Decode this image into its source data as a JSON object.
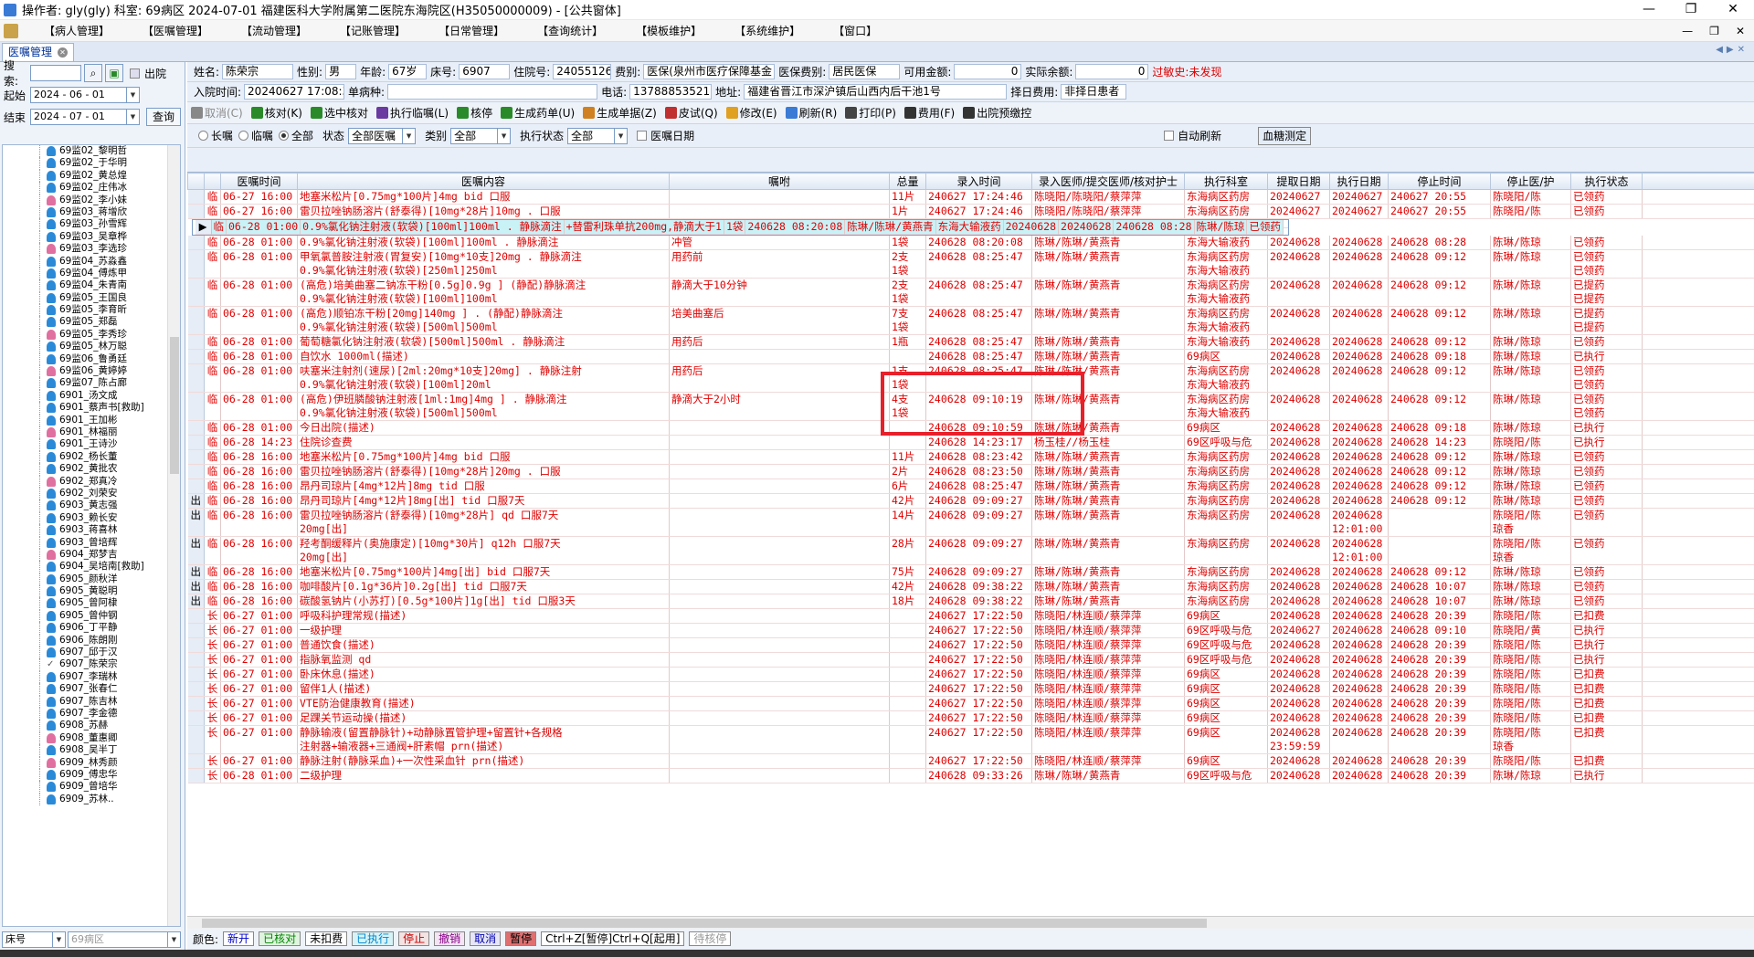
{
  "window": {
    "title": "操作者: gly(gly)  科室: 69病区  2024-07-01  福建医科大学附属第二医院东海院区(H35050000009) - [公共窗体]",
    "controls": [
      "—",
      "❐",
      "✕"
    ]
  },
  "menu": {
    "items": [
      "【病人管理】",
      "【医嘱管理】",
      "【流动管理】",
      "【记账管理】",
      "【日常管理】",
      "【查询统计】",
      "【模板维护】",
      "【系统维护】",
      "【窗口】"
    ],
    "right_controls": [
      "—",
      "❐",
      "✕"
    ]
  },
  "tab": {
    "label": "医嘱管理"
  },
  "left": {
    "search_label": "搜索:",
    "out_label": "出院",
    "start_label": "起始",
    "start_date": "2024 - 06 - 01",
    "end_label": "结束",
    "end_date": "2024 - 07 - 01",
    "query_btn": "查询",
    "bottom_field": "床号",
    "bottom_value": "69病区",
    "patients": [
      {
        "t": "69监02_黎明哲",
        "c": "b"
      },
      {
        "t": "69监02_于华明",
        "c": "b"
      },
      {
        "t": "69监02_黄总煌",
        "c": "b"
      },
      {
        "t": "69监02_庄伟冰",
        "c": "b"
      },
      {
        "t": "69监02_李小妹",
        "c": "p"
      },
      {
        "t": "69监03_蒋增欣",
        "c": "b"
      },
      {
        "t": "69监03_孙雪辉",
        "c": "b"
      },
      {
        "t": "69监03_吴章桦",
        "c": "b"
      },
      {
        "t": "69监03_李选珍",
        "c": "p"
      },
      {
        "t": "69监04_苏淼鑫",
        "c": "b"
      },
      {
        "t": "69监04_傅炼甲",
        "c": "b"
      },
      {
        "t": "69监04_朱青南",
        "c": "b"
      },
      {
        "t": "69监05_王国良",
        "c": "b"
      },
      {
        "t": "69监05_李育昕",
        "c": "b"
      },
      {
        "t": "69监05_郑磊",
        "c": "b"
      },
      {
        "t": "69监05_李秀珍",
        "c": "p"
      },
      {
        "t": "69监05_林万聪",
        "c": "b"
      },
      {
        "t": "69监06_鲁勇廷",
        "c": "b"
      },
      {
        "t": "69监06_黄婷婷",
        "c": "p"
      },
      {
        "t": "69监07_陈占廊",
        "c": "b"
      },
      {
        "t": "6901_汤文成",
        "c": "b"
      },
      {
        "t": "6901_蔡声书[救助]",
        "c": "b"
      },
      {
        "t": "6901_王加彬",
        "c": "b"
      },
      {
        "t": "6901_林福丽",
        "c": "p"
      },
      {
        "t": "6901_王诗沙",
        "c": "b"
      },
      {
        "t": "6902_杨长董",
        "c": "b"
      },
      {
        "t": "6902_黄批农",
        "c": "b"
      },
      {
        "t": "6902_郑真冷",
        "c": "p"
      },
      {
        "t": "6902_刘荣安",
        "c": "b"
      },
      {
        "t": "6903_黄志强",
        "c": "b"
      },
      {
        "t": "6903_赖长安",
        "c": "b"
      },
      {
        "t": "6903_蒋喜林",
        "c": "b"
      },
      {
        "t": "6903_曾培辉",
        "c": "b"
      },
      {
        "t": "6904_郑梦吉",
        "c": "p"
      },
      {
        "t": "6904_吴培南[救助]",
        "c": "b"
      },
      {
        "t": "6905_颜秋洋",
        "c": "b"
      },
      {
        "t": "6905_黄聪明",
        "c": "b"
      },
      {
        "t": "6905_曾阿棣",
        "c": "b"
      },
      {
        "t": "6905_曾仲钢",
        "c": "b"
      },
      {
        "t": "6906_丁平静",
        "c": "b"
      },
      {
        "t": "6906_陈朗刚",
        "c": "b"
      },
      {
        "t": "6907_邱于汉",
        "c": "b"
      },
      {
        "t": "6907_陈荣宗",
        "c": "s"
      },
      {
        "t": "6907_李瑞林",
        "c": "b"
      },
      {
        "t": "6907_张春仁",
        "c": "b"
      },
      {
        "t": "6907_陈吉林",
        "c": "b"
      },
      {
        "t": "6907_李金德",
        "c": "b"
      },
      {
        "t": "6908_苏赫",
        "c": "b"
      },
      {
        "t": "6908_董惠卿",
        "c": "p"
      },
      {
        "t": "6908_吴半丁",
        "c": "b"
      },
      {
        "t": "6909_林秀颜",
        "c": "p"
      },
      {
        "t": "6909_傅忠华",
        "c": "b"
      },
      {
        "t": "6909_曾培华",
        "c": "b"
      },
      {
        "t": "6909_苏林..",
        "c": "b"
      }
    ]
  },
  "patient": {
    "name_l": "姓名:",
    "name": "陈荣宗",
    "sex_l": "性别:",
    "sex": "男",
    "age_l": "年龄:",
    "age": "67岁",
    "bed_l": "床号:",
    "bed": "6907",
    "inp_l": "住院号:",
    "inp": "24055126",
    "fee_l": "费别:",
    "fee": "医保(泉州市医疗保障基金",
    "ins_l": "医保费别:",
    "ins": "居民医保",
    "avail_l": "可用金额:",
    "avail": "0",
    "bal_l": "实际余额:",
    "bal": "0",
    "allergy": "过敏史:未发现",
    "adm_l": "入院时间:",
    "adm": "20240627 17:08:32",
    "dis_l": "单病种:",
    "dis": "",
    "tel_l": "电话:",
    "tel": "13788853521",
    "addr_l": "地址:",
    "addr": "福建省晋江市深沪镇后山西内后干池1号",
    "self_l": "择日费用:",
    "self": "非择日患者"
  },
  "toolbar": [
    "取消(C)",
    "核对(K)",
    "选中核对",
    "执行临嘱(L)",
    "核停",
    "生成药单(U)",
    "生成单据(Z)",
    "皮试(Q)",
    "修改(E)",
    "刷新(R)",
    "打印(P)",
    "费用(F)",
    "出院预缴控"
  ],
  "filter": {
    "long": "长嘱",
    "temp": "临嘱",
    "all": "全部",
    "status_l": "状态",
    "status": "全部医嘱",
    "cat_l": "类别",
    "cat": "全部",
    "exec_l": "执行状态",
    "exec": "全部",
    "date_l": "医嘱日期",
    "auto": "自动刷新",
    "measure": "血糖测定"
  },
  "columns": [
    "医嘱时间",
    "医嘱内容",
    "嘱咐",
    "总量",
    "录入时间",
    "录入医师/提交医师/核对护士",
    "执行科室",
    "提取日期",
    "执行日期",
    "停止时间",
    "停止医/护",
    "执行状态",
    ""
  ],
  "rows": [
    {
      "m": "",
      "t": "临",
      "time": "06-27 16:00",
      "c": "地塞米松片[0.75mg*100片]4mg  bid 口服",
      "z": "",
      "q": "11片",
      "e": "240627 17:24:46",
      "d": "陈晓阳/陈晓阳/蔡萍萍",
      "k": "东海病区药房",
      "f": "20240627",
      "x": "20240627",
      "s": "240627 20:55",
      "sd": "陈晓阳/陈",
      "st": "已领药"
    },
    {
      "m": "",
      "t": "临",
      "time": "06-27 16:00",
      "c": "雷贝拉唑钠肠溶片(舒泰得)[10mg*28片]10mg . 口服",
      "z": "",
      "q": "1片",
      "e": "240627 17:24:46",
      "d": "陈晓阳/陈晓阳/蔡萍萍",
      "k": "东海病区药房",
      "f": "20240627",
      "x": "20240627",
      "s": "240627 20:55",
      "sd": "陈晓阳/陈",
      "st": "已领药"
    },
    {
      "m": "▶",
      "t": "临",
      "time": "06-28 01:00",
      "c": "0.9%氯化钠注射液(软袋)[100ml]100ml . 静脉滴注",
      "z": "+替雷利珠单抗200mg,静滴大于1",
      "q": "1袋",
      "e": "240628 08:20:08",
      "d": "陈琳/陈琳/黄燕青",
      "k": "东海大输液药",
      "f": "20240628",
      "x": "20240628",
      "s": "240628 08:28",
      "sd": "陈琳/陈琼",
      "st": "已领药",
      "sel": true
    },
    {
      "m": "",
      "t": "临",
      "time": "06-28 01:00",
      "c": "0.9%氯化钠注射液(软袋)[100ml]100ml . 静脉滴注",
      "z": "冲管",
      "q": "1袋",
      "e": "240628 08:20:08",
      "d": "陈琳/陈琳/黄燕青",
      "k": "东海大输液药",
      "f": "20240628",
      "x": "20240628",
      "s": "240628 08:28",
      "sd": "陈琳/陈琼",
      "st": "已领药"
    },
    {
      "m": "",
      "t": "临",
      "time": "06-28 01:00",
      "c": "甲氧氯普胺注射液(胃复安)[10mg*10支]20mg . 静脉滴注",
      "c2": "0.9%氯化钠注射液(软袋)[250ml]250ml",
      "z": "用药前",
      "q": "2支",
      "q2": "1袋",
      "e": "240628 08:25:47",
      "d": "陈琳/陈琳/黄燕青",
      "k": "东海病区药房",
      "k2": "东海大输液药",
      "f": "20240628",
      "x": "20240628",
      "s": "240628 09:12",
      "sd": "陈琳/陈琼",
      "st": "已领药",
      "st2": "已领药"
    },
    {
      "m": "",
      "t": "临",
      "time": "06-28 01:00",
      "c": "(高危)培美曲塞二钠冻干粉[0.5g]0.9g ] (静配)静脉滴注",
      "c2": "0.9%氯化钠注射液(软袋)[100ml]100ml",
      "z": "静滴大于10分钟",
      "q": "2支",
      "q2": "1袋",
      "e": "240628 08:25:47",
      "d": "陈琳/陈琳/黄燕青",
      "k": "东海病区药房",
      "k2": "东海大输液药",
      "f": "20240628",
      "x": "20240628",
      "s": "240628 09:12",
      "sd": "陈琳/陈琼",
      "st": "已提药",
      "st2": "已提药"
    },
    {
      "m": "",
      "t": "临",
      "time": "06-28 01:00",
      "c": "(高危)顺铂冻干粉[20mg]140mg  ] . (静配)静脉滴注",
      "c2": "0.9%氯化钠注射液(软袋)[500ml]500ml",
      "z": "培美曲塞后",
      "q": "7支",
      "q2": "1袋",
      "e": "240628 08:25:47",
      "d": "陈琳/陈琳/黄燕青",
      "k": "东海病区药房",
      "k2": "东海大输液药",
      "f": "20240628",
      "x": "20240628",
      "s": "240628 09:12",
      "sd": "陈琳/陈琼",
      "st": "已提药",
      "st2": "已提药"
    },
    {
      "m": "",
      "t": "临",
      "time": "06-28 01:00",
      "c": "葡萄糖氯化钠注射液(软袋)[500ml]500ml . 静脉滴注",
      "z": "用药后",
      "q": "1瓶",
      "e": "240628 08:25:47",
      "d": "陈琳/陈琳/黄燕青",
      "k": "东海大输液药",
      "f": "20240628",
      "x": "20240628",
      "s": "240628 09:12",
      "sd": "陈琳/陈琼",
      "st": "已领药"
    },
    {
      "m": "",
      "t": "临",
      "time": "06-28 01:00",
      "c": "自饮水 1000ml(描述)",
      "z": "",
      "q": "",
      "e": "240628 08:25:47",
      "d": "陈琳/陈琳/黄燕青",
      "k": "69病区",
      "f": "20240628",
      "x": "20240628",
      "s": "240628 09:18",
      "sd": "陈琳/陈琼",
      "st": "已执行"
    },
    {
      "m": "",
      "t": "临",
      "time": "06-28 01:00",
      "c": "呋塞米注射剂(速尿)[2ml:20mg*10支]20mg] . 静脉注射",
      "c2": "0.9%氯化钠注射液(软袋)[100ml]20ml",
      "z": "用药后",
      "q": "1支",
      "q2": "1袋",
      "e": "240628 08:25:47",
      "d": "陈琳/陈琳/黄燕青",
      "k": "东海病区药房",
      "k2": "东海大输液药",
      "f": "20240628",
      "x": "20240628",
      "s": "240628 09:12",
      "sd": "陈琳/陈琼",
      "st": "已领药",
      "st2": "已领药"
    },
    {
      "m": "",
      "t": "临",
      "time": "06-28 01:00",
      "c": "(高危)伊班膦酸钠注射液[1ml:1mg]4mg  ] . 静脉滴注",
      "c2": "0.9%氯化钠注射液(软袋)[500ml]500ml",
      "z": "静滴大于2小时",
      "q": "4支",
      "q2": "1袋",
      "e": "240628 09:10:19",
      "d": "陈琳/陈琳/黄燕青",
      "k": "东海病区药房",
      "k2": "东海大输液药",
      "f": "20240628",
      "x": "20240628",
      "s": "240628 09:12",
      "sd": "陈琳/陈琼",
      "st": "已领药",
      "st2": "已领药"
    },
    {
      "m": "",
      "t": "临",
      "time": "06-28 01:00",
      "c": "今日出院(描述)",
      "z": "",
      "q": "",
      "e": "240628 09:10:59",
      "d": "陈琳/陈琳/黄燕青",
      "k": "69病区",
      "f": "20240628",
      "x": "20240628",
      "s": "240628 09:18",
      "sd": "陈琳/陈琼",
      "st": "已执行"
    },
    {
      "m": "",
      "t": "临",
      "time": "06-28 14:23",
      "c": "住院诊查费",
      "z": "",
      "q": "",
      "e": "240628 14:23:17",
      "d": "杨玉桂//杨玉桂",
      "k": "69区呼吸与危",
      "f": "20240628",
      "x": "20240628",
      "s": "240628 14:23",
      "sd": "陈晓阳/陈",
      "st": "已执行"
    },
    {
      "m": "",
      "t": "临",
      "time": "06-28 16:00",
      "c": "地塞米松片[0.75mg*100片]4mg  bid 口服",
      "z": "",
      "q": "11片",
      "e": "240628 08:23:42",
      "d": "陈琳/陈琳/黄燕青",
      "k": "东海病区药房",
      "f": "20240628",
      "x": "20240628",
      "s": "240628 09:12",
      "sd": "陈琳/陈琼",
      "st": "已领药"
    },
    {
      "m": "",
      "t": "临",
      "time": "06-28 16:00",
      "c": "雷贝拉唑钠肠溶片(舒泰得)[10mg*28片]20mg . 口服",
      "z": "",
      "q": "2片",
      "e": "240628 08:23:50",
      "d": "陈琳/陈琳/黄燕青",
      "k": "东海病区药房",
      "f": "20240628",
      "x": "20240628",
      "s": "240628 09:12",
      "sd": "陈琳/陈琼",
      "st": "已领药"
    },
    {
      "m": "",
      "t": "临",
      "time": "06-28 16:00",
      "c": "昂丹司琼片[4mg*12片]8mg  tid 口服",
      "z": "",
      "q": "6片",
      "e": "240628 08:25:47",
      "d": "陈琳/陈琳/黄燕青",
      "k": "东海病区药房",
      "f": "20240628",
      "x": "20240628",
      "s": "240628 09:12",
      "sd": "陈琳/陈琼",
      "st": "已领药"
    },
    {
      "m": "出",
      "t": "临",
      "time": "06-28 16:00",
      "c": "昂丹司琼片[4mg*12片]8mg[出]  tid 口服7天",
      "z": "",
      "q": "42片",
      "e": "240628 09:09:27",
      "d": "陈琳/陈琳/黄燕青",
      "k": "东海病区药房",
      "f": "20240628",
      "x": "20240628",
      "s": "240628 09:12",
      "sd": "陈琳/陈琼",
      "st": "已领药"
    },
    {
      "m": "出",
      "t": "临",
      "time": "06-28 16:00",
      "c": "雷贝拉唑钠肠溶片(舒泰得)[10mg*28片]      qd 口服7天",
      "c2": "20mg[出]",
      "z": "",
      "q": "14片",
      "e": "240628 09:09:27",
      "d": "陈琳/陈琳/黄燕青",
      "k": "东海病区药房",
      "f": "20240628",
      "x": "20240628",
      "x2": "12:01:00",
      "s": "",
      "sd": "陈晓阳/陈",
      "sd2": "琼香",
      "st": "已领药"
    },
    {
      "m": "出",
      "t": "临",
      "time": "06-28 16:00",
      "c": "羟考酮缓释片(奥施康定)[10mg*30片]     q12h 口服7天",
      "c2": "20mg[出]",
      "z": "",
      "q": "28片",
      "e": "240628 09:09:27",
      "d": "陈琳/陈琳/黄燕青",
      "k": "东海病区药房",
      "f": "20240628",
      "x": "20240628",
      "x2": "12:01:00",
      "s": "",
      "sd": "陈晓阳/陈",
      "sd2": "琼香",
      "st": "已领药"
    },
    {
      "m": "出",
      "t": "临",
      "time": "06-28 16:00",
      "c": "地塞米松片[0.75mg*100片]4mg[出]  bid 口服7天",
      "z": "",
      "q": "75片",
      "e": "240628 09:09:27",
      "d": "陈琳/陈琳/黄燕青",
      "k": "东海病区药房",
      "f": "20240628",
      "x": "20240628",
      "s": "240628 09:12",
      "sd": "陈琳/陈琼",
      "st": "已领药"
    },
    {
      "m": "出",
      "t": "临",
      "time": "06-28 16:00",
      "c": "咖啡酸片[0.1g*36片]0.2g[出]  tid 口服7天",
      "z": "",
      "q": "42片",
      "e": "240628 09:38:22",
      "d": "陈琳/陈琳/黄燕青",
      "k": "东海病区药房",
      "f": "20240628",
      "x": "20240628",
      "s": "240628 10:07",
      "sd": "陈琳/陈琼",
      "st": "已领药"
    },
    {
      "m": "出",
      "t": "临",
      "time": "06-28 16:00",
      "c": "碳酸氢钠片(小苏打)[0.5g*100片]1g[出]  tid 口服3天",
      "z": "",
      "q": "18片",
      "e": "240628 09:38:22",
      "d": "陈琳/陈琳/黄燕青",
      "k": "东海病区药房",
      "f": "20240628",
      "x": "20240628",
      "s": "240628 10:07",
      "sd": "陈琳/陈琼",
      "st": "已领药"
    },
    {
      "m": "",
      "t": "长",
      "time": "06-27 01:00",
      "c": "呼吸科护理常规(描述)",
      "z": "",
      "q": "",
      "e": "240627 17:22:50",
      "d": "陈晓阳/林连顺/蔡萍萍",
      "k": "69病区",
      "f": "20240628",
      "x": "20240628",
      "s": "240628 20:39",
      "sd": "陈晓阳/陈",
      "st": "已扣费"
    },
    {
      "m": "",
      "t": "长",
      "time": "06-27 01:00",
      "c": "一级护理",
      "z": "",
      "q": "",
      "e": "240627 17:22:50",
      "d": "陈晓阳/林连顺/蔡萍萍",
      "k": "69区呼吸与危",
      "f": "20240627",
      "x": "20240628",
      "s": "240628 09:10",
      "sd": "陈晓阳/黄",
      "st": "已执行"
    },
    {
      "m": "",
      "t": "长",
      "time": "06-27 01:00",
      "c": "普通饮食(描述)",
      "z": "",
      "q": "",
      "e": "240627 17:22:50",
      "d": "陈晓阳/林连顺/蔡萍萍",
      "k": "69区呼吸与危",
      "f": "20240628",
      "x": "20240628",
      "s": "240628 20:39",
      "sd": "陈晓阳/陈",
      "st": "已执行"
    },
    {
      "m": "",
      "t": "长",
      "time": "06-27 01:00",
      "c": "指脉氧监测 qd",
      "z": "",
      "q": "",
      "e": "240627 17:22:50",
      "d": "陈晓阳/林连顺/蔡萍萍",
      "k": "69区呼吸与危",
      "f": "20240628",
      "x": "20240628",
      "s": "240628 20:39",
      "sd": "陈晓阳/陈",
      "st": "已执行"
    },
    {
      "m": "",
      "t": "长",
      "time": "06-27 01:00",
      "c": "卧床休息(描述)",
      "z": "",
      "q": "",
      "e": "240627 17:22:50",
      "d": "陈晓阳/林连顺/蔡萍萍",
      "k": "69病区",
      "f": "20240628",
      "x": "20240628",
      "s": "240628 20:39",
      "sd": "陈晓阳/陈",
      "st": "已扣费"
    },
    {
      "m": "",
      "t": "长",
      "time": "06-27 01:00",
      "c": "留伴1人(描述)",
      "z": "",
      "q": "",
      "e": "240627 17:22:50",
      "d": "陈晓阳/林连顺/蔡萍萍",
      "k": "69病区",
      "f": "20240628",
      "x": "20240628",
      "s": "240628 20:39",
      "sd": "陈晓阳/陈",
      "st": "已扣费"
    },
    {
      "m": "",
      "t": "长",
      "time": "06-27 01:00",
      "c": "VTE防治健康教育(描述)",
      "z": "",
      "q": "",
      "e": "240627 17:22:50",
      "d": "陈晓阳/林连顺/蔡萍萍",
      "k": "69病区",
      "f": "20240628",
      "x": "20240628",
      "s": "240628 20:39",
      "sd": "陈晓阳/陈",
      "st": "已扣费"
    },
    {
      "m": "",
      "t": "长",
      "time": "06-27 01:00",
      "c": "足踝关节运动操(描述)",
      "z": "",
      "q": "",
      "e": "240627 17:22:50",
      "d": "陈晓阳/林连顺/蔡萍萍",
      "k": "69病区",
      "f": "20240628",
      "x": "20240628",
      "s": "240628 20:39",
      "sd": "陈晓阳/陈",
      "st": "已扣费"
    },
    {
      "m": "",
      "t": "长",
      "time": "06-27 01:00",
      "c": "静脉输液(留置静脉针)+动静脉置管护理+留置针+各规格",
      "c2": "注射器+输液器+三通阀+肝素帽 prn(描述)",
      "z": "",
      "q": "",
      "e": "240627 17:22:50",
      "d": "陈晓阳/林连顺/蔡萍萍",
      "k": "69病区",
      "f": "20240628",
      "f2": "23:59:59",
      "x": "20240628",
      "s": "240628 20:39",
      "sd": "陈晓阳/陈",
      "sd2": "琼香",
      "st": "已扣费"
    },
    {
      "m": "",
      "t": "长",
      "time": "06-27 01:00",
      "c": "静脉注射(静脉采血)+一次性采血针 prn(描述)",
      "z": "",
      "q": "",
      "e": "240627 17:22:50",
      "d": "陈晓阳/林连顺/蔡萍萍",
      "k": "69病区",
      "f": "20240628",
      "x": "20240628",
      "s": "240628 20:39",
      "sd": "陈晓阳/陈",
      "st": "已扣费"
    },
    {
      "m": "",
      "t": "长",
      "time": "06-28 01:00",
      "c": "二级护理",
      "z": "",
      "q": "",
      "e": "240628 09:33:26",
      "d": "陈琳/陈琳/黄燕青",
      "k": "69区呼吸与危",
      "f": "20240628",
      "x": "20240628",
      "s": "240628 20:39",
      "sd": "陈琳/陈琼",
      "st": "已执行"
    }
  ],
  "legend": {
    "label": "颜色:",
    "items": [
      {
        "t": "新开",
        "c": "#0000cc"
      },
      {
        "t": "已核对",
        "c": "#008800"
      },
      {
        "t": "未扣费",
        "c": "#000000"
      },
      {
        "t": "已执行",
        "c": "#0088cc"
      },
      {
        "t": "停止",
        "c": "#cc0000"
      },
      {
        "t": "撤销",
        "c": "#880088"
      },
      {
        "t": "取消",
        "c": "#0000aa"
      },
      {
        "t": "暂停",
        "c": "#000000"
      }
    ],
    "shortcut": "Ctrl+Z[暂停]Ctrl+Q[起用]",
    "pending": "待核停"
  }
}
